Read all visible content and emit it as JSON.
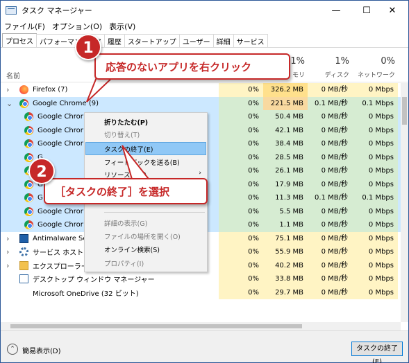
{
  "window": {
    "title": "タスク マネージャー",
    "controls": {
      "minimize": "—",
      "maximize": "☐",
      "close": "✕"
    }
  },
  "menu": [
    "ファイル(F)",
    "オプション(O)",
    "表示(V)"
  ],
  "tabs": [
    "プロセス",
    "パフォーマンス",
    "ア",
    "履歴",
    "スタートアップ",
    "ユーザー",
    "詳細",
    "サービス"
  ],
  "header": {
    "name_label": "名前",
    "columns": [
      {
        "pct": "",
        "label": ""
      },
      {
        "pct": "1%",
        "label": "モリ"
      },
      {
        "pct": "1%",
        "label": "ディスク"
      },
      {
        "pct": "0%",
        "label": "ネットワーク"
      }
    ]
  },
  "rows": [
    {
      "name": "Firefox (7)",
      "icon": "firefox-icon",
      "expander": "›",
      "cpu": "0%",
      "mem": "326.2 MB",
      "disk": "0 MB/秒",
      "net": "0 Mbps",
      "selected": false,
      "indent": 0
    },
    {
      "name": "Google Chrome (9)",
      "icon": "chrome-icon",
      "expander": "⌄",
      "cpu": "0%",
      "mem": "221.5 MB",
      "disk": "0.1 MB/秒",
      "net": "0.1 Mbps",
      "selected": true,
      "indent": 0
    },
    {
      "name": "Google Chrom",
      "icon": "chrome-icon",
      "expander": "",
      "cpu": "0%",
      "mem": "50.4 MB",
      "disk": "0 MB/秒",
      "net": "0 Mbps",
      "selected": true,
      "indent": 1
    },
    {
      "name": "Google Chrom",
      "icon": "chrome-icon",
      "expander": "",
      "cpu": "0%",
      "mem": "42.1 MB",
      "disk": "0 MB/秒",
      "net": "0 Mbps",
      "selected": true,
      "indent": 1
    },
    {
      "name": "Google Chrom",
      "icon": "chrome-icon",
      "expander": "",
      "cpu": "0%",
      "mem": "38.4 MB",
      "disk": "0 MB/秒",
      "net": "0 Mbps",
      "selected": true,
      "indent": 1
    },
    {
      "name": "G",
      "icon": "chrome-icon",
      "expander": "",
      "cpu": "0%",
      "mem": "28.5 MB",
      "disk": "0 MB/秒",
      "net": "0 Mbps",
      "selected": true,
      "indent": 1
    },
    {
      "name": "G",
      "icon": "chrome-icon",
      "expander": "",
      "cpu": "0%",
      "mem": "26.1 MB",
      "disk": "0 MB/秒",
      "net": "0 Mbps",
      "selected": true,
      "indent": 1
    },
    {
      "name": "G",
      "icon": "chrome-icon",
      "expander": "",
      "cpu": "0%",
      "mem": "17.9 MB",
      "disk": "0 MB/秒",
      "net": "0 Mbps",
      "selected": true,
      "indent": 1
    },
    {
      "name": "G",
      "icon": "chrome-icon",
      "expander": "",
      "cpu": "0%",
      "mem": "11.3 MB",
      "disk": "0.1 MB/秒",
      "net": "0.1 Mbps",
      "selected": true,
      "indent": 1
    },
    {
      "name": "Google Chrom",
      "icon": "chrome-icon",
      "expander": "",
      "cpu": "0%",
      "mem": "5.5 MB",
      "disk": "0 MB/秒",
      "net": "0 Mbps",
      "selected": true,
      "indent": 1
    },
    {
      "name": "Google Chrom",
      "icon": "chrome-icon",
      "expander": "",
      "cpu": "0%",
      "mem": "1.1 MB",
      "disk": "0 MB/秒",
      "net": "0 Mbps",
      "selected": true,
      "indent": 1
    },
    {
      "name": "Antimalware Se",
      "icon": "shield-box-icon",
      "expander": "›",
      "cpu": "0%",
      "mem": "75.1 MB",
      "disk": "0 MB/秒",
      "net": "0 Mbps",
      "selected": false,
      "indent": 0
    },
    {
      "name": "サービス ホスト: Sy",
      "icon": "gear-icon",
      "expander": "›",
      "cpu": "0%",
      "mem": "55.9 MB",
      "disk": "0 MB/秒",
      "net": "0 Mbps",
      "selected": false,
      "indent": 0
    },
    {
      "name": "エクスプローラー (7)",
      "icon": "folder-icon",
      "expander": "›",
      "cpu": "0%",
      "mem": "40.2 MB",
      "disk": "0 MB/秒",
      "net": "0 Mbps",
      "selected": false,
      "indent": 0
    },
    {
      "name": "デスクトップ ウィンドウ マネージャー",
      "icon": "desktop-window-icon",
      "expander": "",
      "cpu": "0%",
      "mem": "33.8 MB",
      "disk": "0 MB/秒",
      "net": "0 Mbps",
      "selected": false,
      "indent": 0
    },
    {
      "name": "Microsoft OneDrive (32 ビット)",
      "icon": "cloud-icon",
      "expander": "",
      "cpu": "0%",
      "mem": "29.7 MB",
      "disk": "0 MB/秒",
      "net": "0 Mbps",
      "selected": false,
      "indent": 0
    }
  ],
  "context_menu": {
    "items": [
      {
        "label": "折りたたむ(P)",
        "state": "bold"
      },
      {
        "label": "切り替え(T)",
        "state": "disabled"
      },
      {
        "label": "タスクの終了(E)",
        "state": "highlighted"
      },
      {
        "label": "フィードバックを送る(B)",
        "state": "normal"
      },
      {
        "label": "リソース値(V)",
        "state": "normal",
        "submenu": "›"
      },
      {
        "label": "詳細の表示(G)",
        "state": "disabled"
      },
      {
        "label": "ファイルの場所を開く(O)",
        "state": "disabled"
      },
      {
        "label": "オンライン検索(S)",
        "state": "normal"
      },
      {
        "label": "プロパティ(I)",
        "state": "disabled"
      }
    ]
  },
  "callouts": [
    {
      "number": "1",
      "text": "応答のないアプリを右クリック"
    },
    {
      "number": "2",
      "text": "［タスクの終了］を選択"
    }
  ],
  "footer": {
    "fewer_details_icon": "⌃",
    "fewer_details": "簡易表示(D)",
    "end_task": "タスクの終了(E)"
  }
}
